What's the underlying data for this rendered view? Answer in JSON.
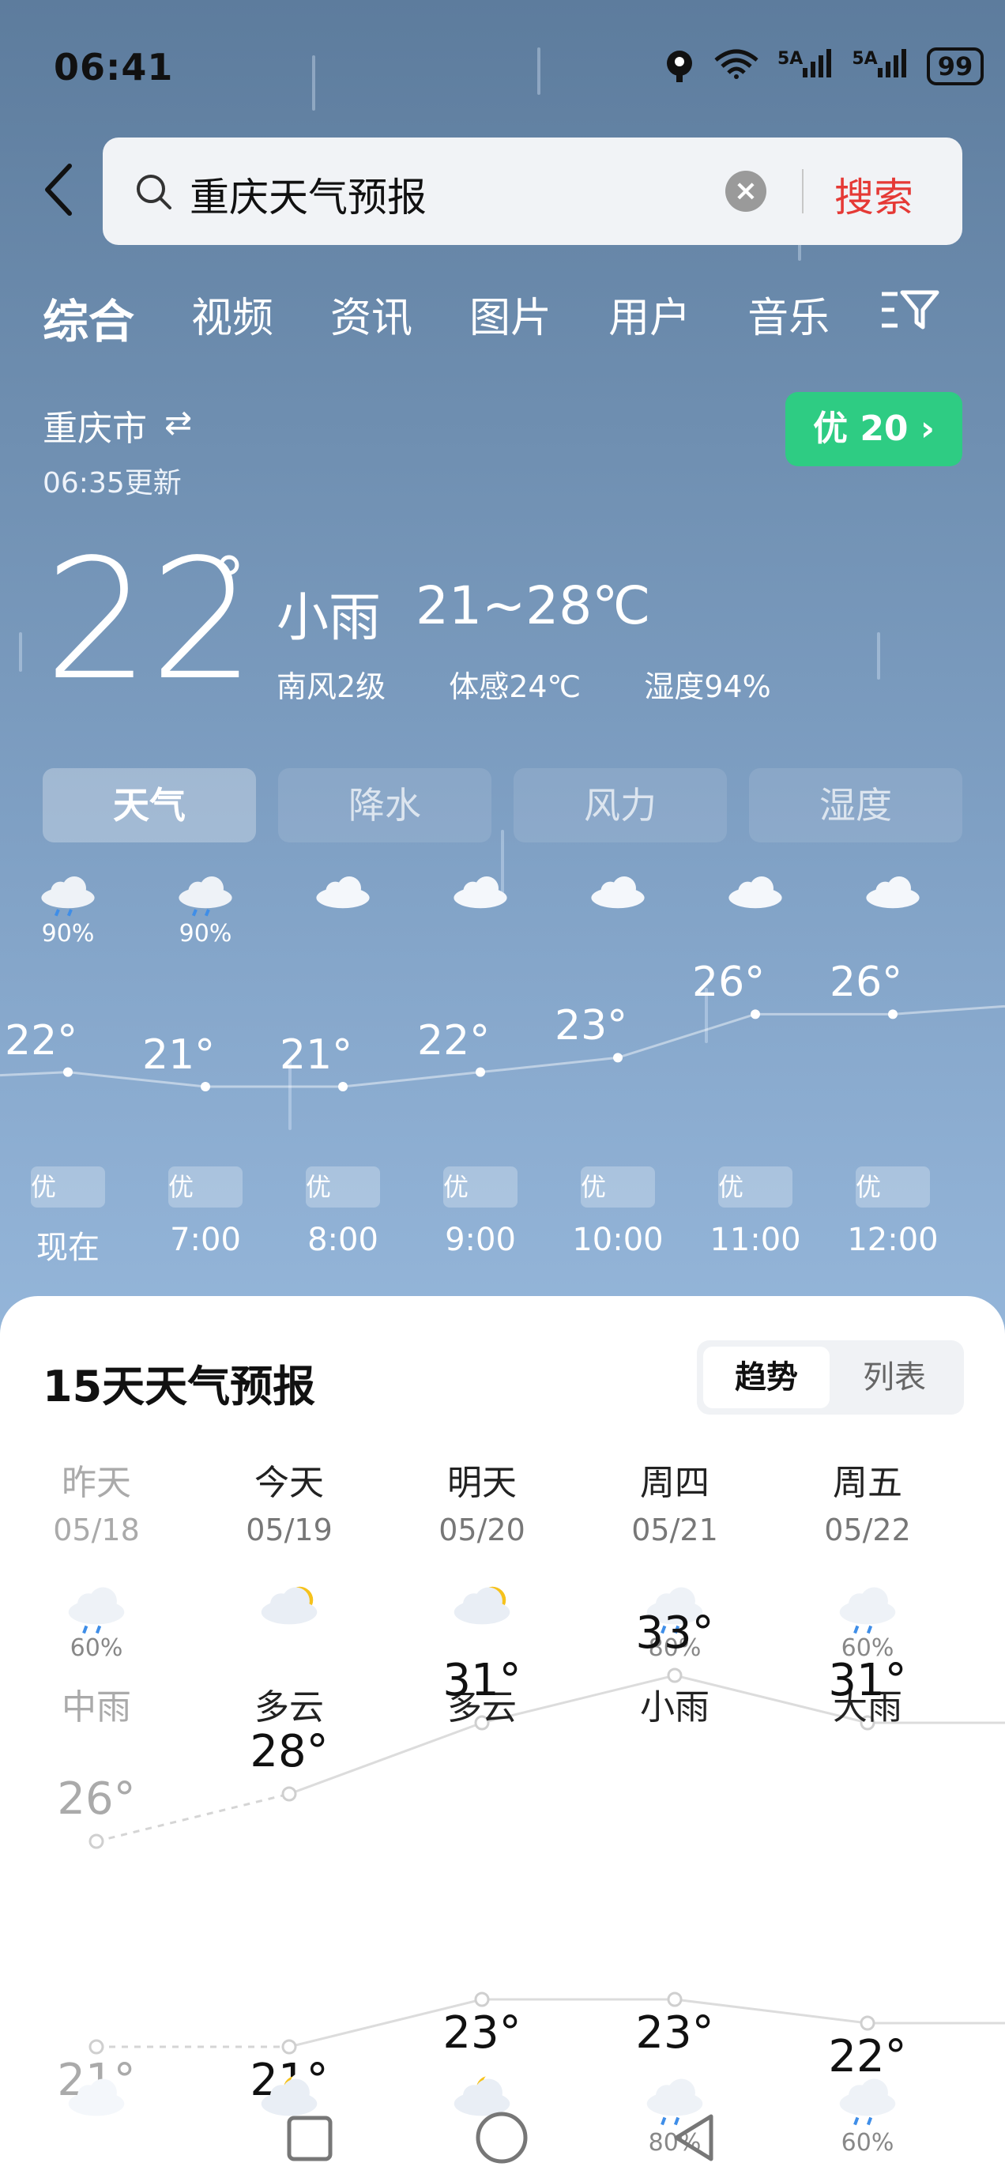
{
  "status_bar": {
    "time": "06:41",
    "signal1": "5A",
    "signal2": "5A",
    "battery": "99",
    "wifi_sup": "6"
  },
  "search": {
    "query": "重庆天气预报",
    "button": "搜索"
  },
  "tabs": [
    "综合",
    "视频",
    "资讯",
    "图片",
    "用户",
    "音乐"
  ],
  "location": {
    "city": "重庆市",
    "updated": "06:35更新"
  },
  "aqi": {
    "label": "优 20 ›",
    "color": "#2ecc83"
  },
  "current": {
    "temp": "22",
    "deg": "°",
    "condition": "小雨",
    "range": "21~28℃",
    "wind": "南风2级",
    "feels_like": "体感24℃",
    "humidity": "湿度94%"
  },
  "subtabs": [
    "天气",
    "降水",
    "风力",
    "湿度"
  ],
  "hourly": [
    {
      "icon": "rain-cloud-icon",
      "pct": "90%",
      "temp": "22°",
      "temp_value": 22,
      "aqi": "优",
      "time": "现在"
    },
    {
      "icon": "rain-cloud-icon",
      "pct": "90%",
      "temp": "21°",
      "temp_value": 21,
      "aqi": "优",
      "time": "7:00"
    },
    {
      "icon": "cloud-icon",
      "pct": "",
      "temp": "21°",
      "temp_value": 21,
      "aqi": "优",
      "time": "8:00"
    },
    {
      "icon": "cloud-icon",
      "pct": "",
      "temp": "22°",
      "temp_value": 22,
      "aqi": "优",
      "time": "9:00"
    },
    {
      "icon": "cloud-icon",
      "pct": "",
      "temp": "23°",
      "temp_value": 23,
      "aqi": "优",
      "time": "10:00"
    },
    {
      "icon": "cloud-icon",
      "pct": "",
      "temp": "26°",
      "temp_value": 26,
      "aqi": "优",
      "time": "11:00"
    },
    {
      "icon": "cloud-icon",
      "pct": "",
      "temp": "26°",
      "temp_value": 26,
      "aqi": "优",
      "time": "12:00"
    }
  ],
  "forecast": {
    "title": "15天天气预报",
    "toggle": {
      "trend": "趋势",
      "list": "列表"
    },
    "days": [
      {
        "day": "昨天",
        "date": "05/18",
        "icon": "rain-cloud-icon",
        "pct": "60%",
        "cond": "中雨",
        "hi": "26°",
        "hi_value": 26,
        "lo": "21°",
        "lo_value": 21,
        "night_icon": "cloud-icon",
        "night_pct": ""
      },
      {
        "day": "今天",
        "date": "05/19",
        "icon": "partly-cloudy-icon",
        "pct": "",
        "cond": "多云",
        "hi": "28°",
        "hi_value": 28,
        "lo": "21°",
        "lo_value": 21,
        "night_icon": "moon-cloud-icon",
        "night_pct": ""
      },
      {
        "day": "明天",
        "date": "05/20",
        "icon": "partly-cloudy-icon",
        "pct": "",
        "cond": "多云",
        "hi": "31°",
        "hi_value": 31,
        "lo": "23°",
        "lo_value": 23,
        "night_icon": "moon-cloud-icon",
        "night_pct": ""
      },
      {
        "day": "周四",
        "date": "05/21",
        "icon": "rain-cloud-icon",
        "pct": "80%",
        "cond": "小雨",
        "hi": "33°",
        "hi_value": 33,
        "lo": "23°",
        "lo_value": 23,
        "night_icon": "rain-cloud-icon",
        "night_pct": "80%"
      },
      {
        "day": "周五",
        "date": "05/22",
        "icon": "rain-cloud-icon",
        "pct": "60%",
        "cond": "大雨",
        "hi": "31°",
        "hi_value": 31,
        "lo": "22°",
        "lo_value": 22,
        "night_icon": "rain-cloud-icon",
        "night_pct": "60%"
      }
    ]
  }
}
